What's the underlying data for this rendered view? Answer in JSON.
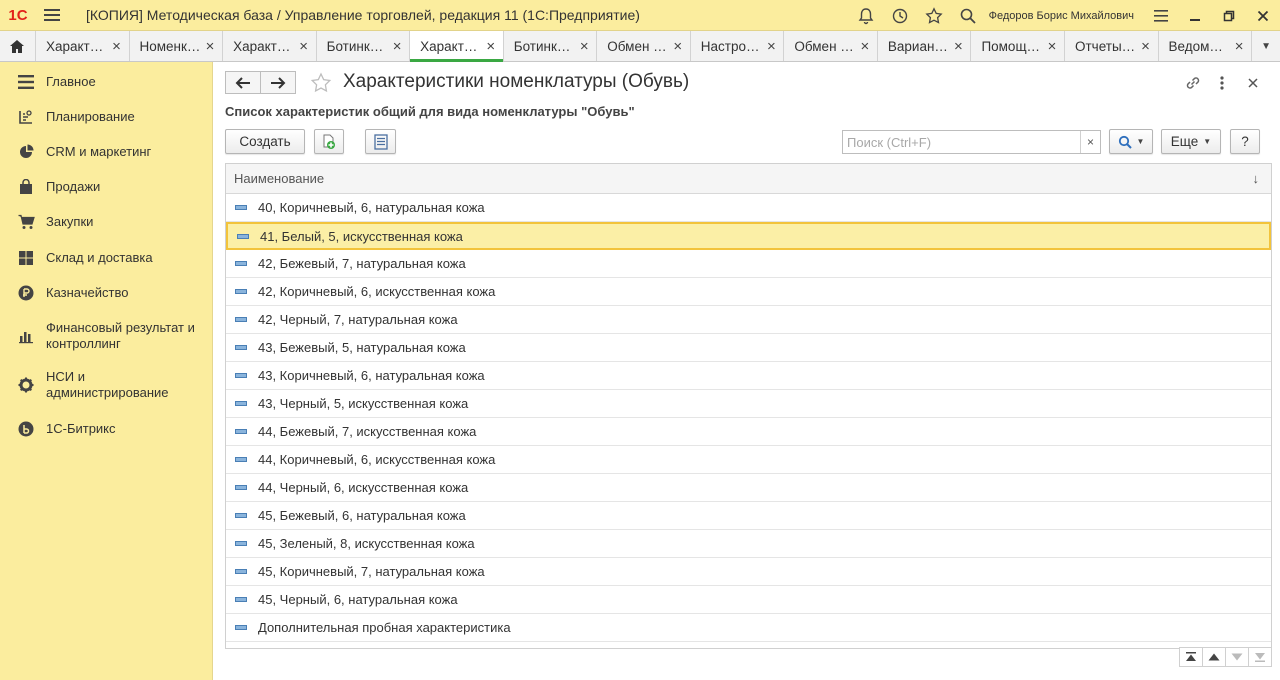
{
  "titlebar": {
    "logo": "1С",
    "title": "[КОПИЯ] Методическая база / Управление торговлей, редакция 11  (1С:Предприятие)",
    "user": "Федоров Борис Михайлович"
  },
  "tabs": [
    {
      "label": "Характ…",
      "active": false
    },
    {
      "label": "Номенк…",
      "active": false
    },
    {
      "label": "Характ…",
      "active": false
    },
    {
      "label": "Ботинк…",
      "active": false
    },
    {
      "label": "Характ…",
      "active": true
    },
    {
      "label": "Ботинк…",
      "active": false
    },
    {
      "label": "Обмен …",
      "active": false
    },
    {
      "label": "Настро…",
      "active": false
    },
    {
      "label": "Обмен …",
      "active": false
    },
    {
      "label": "Вариан…",
      "active": false
    },
    {
      "label": "Помощ…",
      "active": false
    },
    {
      "label": "Отчеты…",
      "active": false
    },
    {
      "label": "Ведом…",
      "active": false
    }
  ],
  "sidebar": {
    "items": [
      {
        "label": "Главное",
        "icon": "menu-icon"
      },
      {
        "label": "Планирование",
        "icon": "planning-icon"
      },
      {
        "label": "CRM и маркетинг",
        "icon": "pie-chart-icon"
      },
      {
        "label": "Продажи",
        "icon": "shopping-bag-icon"
      },
      {
        "label": "Закупки",
        "icon": "cart-icon"
      },
      {
        "label": "Склад и доставка",
        "icon": "warehouse-icon"
      },
      {
        "label": "Казначейство",
        "icon": "ruble-icon"
      },
      {
        "label": "Финансовый результат и контроллинг",
        "icon": "bar-chart-icon"
      },
      {
        "label": "НСИ и администрирование",
        "icon": "gear-icon"
      },
      {
        "label": "1С-Битрикс",
        "icon": "bitrix-icon"
      }
    ]
  },
  "page": {
    "title": "Характеристики номенклатуры (Обувь)",
    "subtitle": "Список характеристик общий для вида номенклатуры \"Обувь\""
  },
  "toolbar": {
    "create_label": "Создать",
    "search_placeholder": "Поиск (Ctrl+F)",
    "more_label": "Еще",
    "help_label": "?"
  },
  "table": {
    "column": "Наименование",
    "selected_index": 1,
    "rows": [
      "40, Коричневый, 6, натуральная кожа",
      "41, Белый, 5, искусственная кожа",
      "42, Бежевый, 7, натуральная кожа",
      "42, Коричневый, 6, искусственная кожа",
      "42, Черный, 7, натуральная кожа",
      "43, Бежевый, 5, натуральная кожа",
      "43, Коричневый, 6, натуральная кожа",
      "43, Черный, 5, искусственная кожа",
      "44, Бежевый, 7, искусственная кожа",
      "44, Коричневый, 6, искусственная кожа",
      "44, Черный, 6, искусственная кожа",
      "45, Бежевый, 6, натуральная кожа",
      "45, Зеленый, 8, искусственная кожа",
      "45, Коричневый, 7, натуральная кожа",
      "45, Черный, 6, натуральная кожа",
      "Дополнительная пробная характеристика"
    ]
  },
  "colors": {
    "sidebar_bg": "#fbed9e",
    "active_tab_accent": "#3aa843",
    "selected_row_bg": "#fbefa6",
    "selected_row_border": "#f2c33b",
    "logo": "#e2231a"
  }
}
